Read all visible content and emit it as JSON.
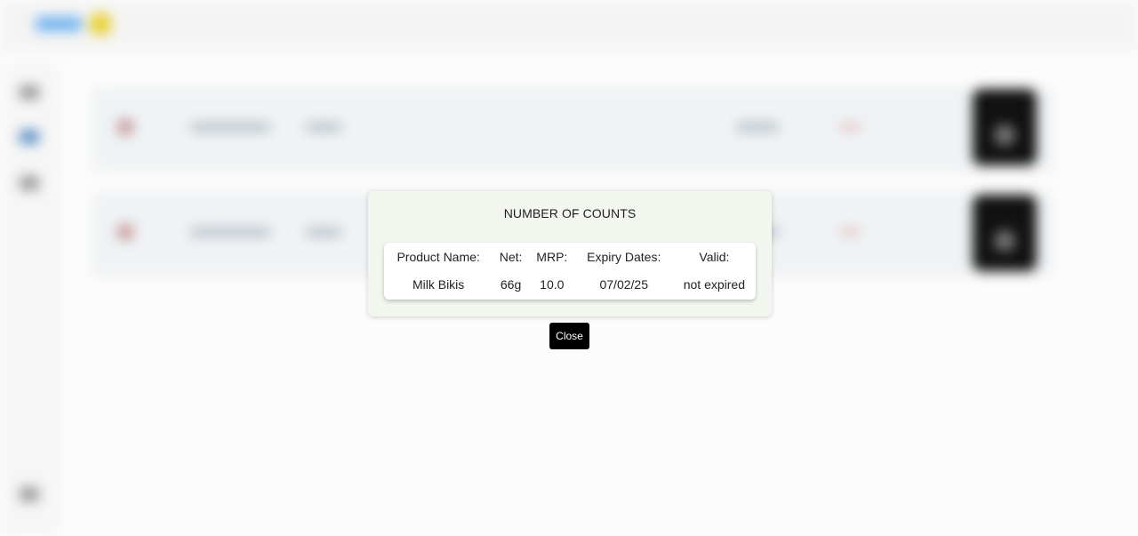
{
  "modal": {
    "title": "NUMBER OF COUNTS",
    "headers": {
      "product_name": "Product Name:",
      "net": "Net:",
      "mrp": "MRP:",
      "expiry": "Expiry Dates:",
      "valid": "Valid:"
    },
    "row": {
      "product_name": "Milk Bikis",
      "net": "66g",
      "mrp": "10.0",
      "expiry": "07/02/25",
      "valid": "not expired"
    },
    "close_label": "Close"
  },
  "colors": {
    "modal_bg": "#f2f6ef",
    "close_button_bg": "#000000",
    "brand_accent": "#6fb3f0"
  }
}
